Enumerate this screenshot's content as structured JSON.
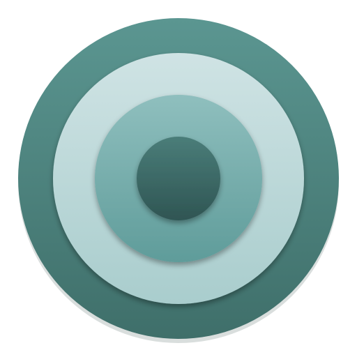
{
  "icon": {
    "name": "target-icon",
    "ring_count": 4,
    "colors": {
      "outer_ring_top": "#5b9691",
      "outer_ring_bottom": "#3f6f6a",
      "light_ring_top": "#cfe3e4",
      "light_ring_bottom": "#a9cdcd",
      "mid_ring_top": "#8fbfbe",
      "mid_ring_bottom": "#5f9c9a",
      "center_top": "#4a7d79",
      "center_bottom": "#2f5553",
      "shadow": "#2c4644"
    }
  }
}
